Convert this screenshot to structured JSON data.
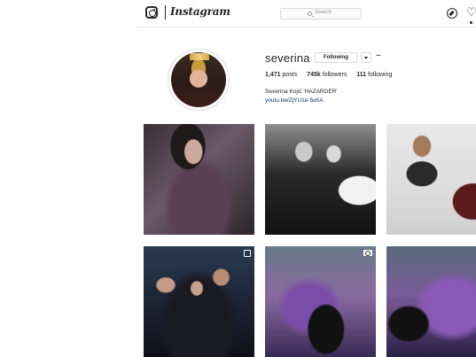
{
  "header": {
    "logo_text": "Instagram",
    "search_placeholder": "Search"
  },
  "profile": {
    "username": "severina",
    "following_button": "Following",
    "more_button": "···",
    "stats": [
      {
        "value": "1,471",
        "label": "posts"
      },
      {
        "value": "745k",
        "label": "followers"
      },
      {
        "value": "111",
        "label": "following"
      }
    ],
    "bio_name": "Severina Kojić 'HAZARDER'",
    "bio_link": "youtu.be/ZjYU1e-5e5A"
  },
  "posts": [
    {
      "id": 1,
      "overlay": "none"
    },
    {
      "id": 2,
      "overlay": "none"
    },
    {
      "id": 3,
      "overlay": "none"
    },
    {
      "id": 4,
      "overlay": "multi-photo-icon"
    },
    {
      "id": 5,
      "overlay": "video-icon"
    },
    {
      "id": 6,
      "overlay": "none"
    }
  ]
}
